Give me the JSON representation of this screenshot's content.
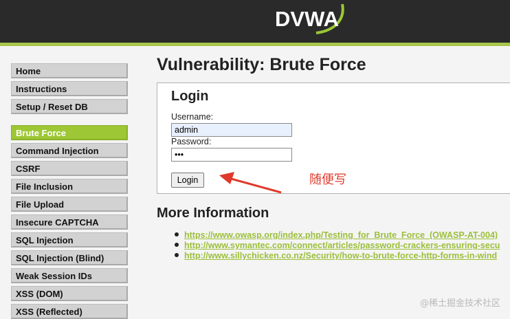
{
  "brand": {
    "logo_text": "DVWA",
    "accent_color": "#9dc735",
    "header_color": "#2a2a2a"
  },
  "sidebar": {
    "groups": [
      [
        "Home",
        "Instructions",
        "Setup / Reset DB"
      ],
      [
        "Brute Force",
        "Command Injection",
        "CSRF",
        "File Inclusion",
        "File Upload",
        "Insecure CAPTCHA",
        "SQL Injection",
        "SQL Injection (Blind)",
        "Weak Session IDs",
        "XSS (DOM)",
        "XSS (Reflected)"
      ]
    ],
    "selected": "Brute Force"
  },
  "main": {
    "title": "Vulnerability: Brute Force",
    "login": {
      "heading": "Login",
      "username_label": "Username:",
      "username_value": "admin",
      "password_label": "Password:",
      "password_value": "•••",
      "button_label": "Login"
    },
    "annotation": "随便写",
    "more_info": {
      "heading": "More Information",
      "links": [
        "https://www.owasp.org/index.php/Testing_for_Brute_Force_(OWASP-AT-004)",
        "http://www.symantec.com/connect/articles/password-crackers-ensuring-secu",
        "http://www.sillychicken.co.nz/Security/how-to-brute-force-http-forms-in-wind"
      ]
    }
  },
  "watermark": "@稀土掘金技术社区"
}
